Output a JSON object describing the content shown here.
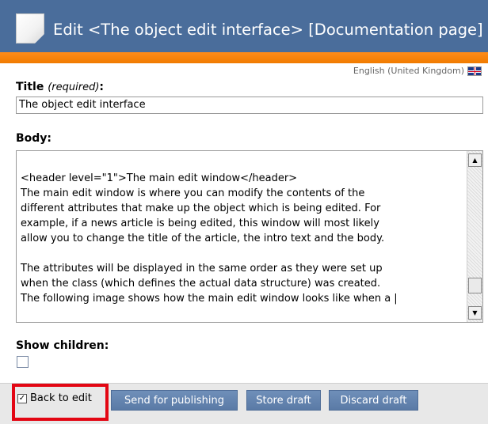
{
  "header": {
    "title": "Edit <The object edit interface> [Documentation page]"
  },
  "language": {
    "label": "English (United Kingdom)",
    "flag_icon": "uk-flag-icon"
  },
  "fields": {
    "title": {
      "label": "Title",
      "required_note": "(required)",
      "colon": ":",
      "value": "The object edit interface"
    },
    "body": {
      "label": "Body:",
      "text": "\n<header level=\"1\">The main edit window</header>\nThe main edit window is where you can modify the contents of the\ndifferent attributes that make up the object which is being edited. For\nexample, if a news article is being edited, this window will most likely\nallow you to change the title of the article, the intro text and the body.\n\nThe attributes will be displayed in the same order as they were set up\nwhen the class (which defines the actual data structure) was created.\nThe following image shows how the main edit window looks like when a |"
    },
    "show_children": {
      "label": "Show children:",
      "checked": false
    }
  },
  "footer": {
    "back_to_edit": {
      "label": "Back to edit",
      "checked": true
    },
    "buttons": {
      "send_for_publishing": "Send for publishing",
      "store_draft": "Store draft",
      "discard_draft": "Discard draft"
    }
  },
  "colors": {
    "header_bg": "#4a6d9b",
    "accent_orange": "#f07b00",
    "button_bg": "#5a7aa6",
    "highlight_red": "#e30613"
  }
}
